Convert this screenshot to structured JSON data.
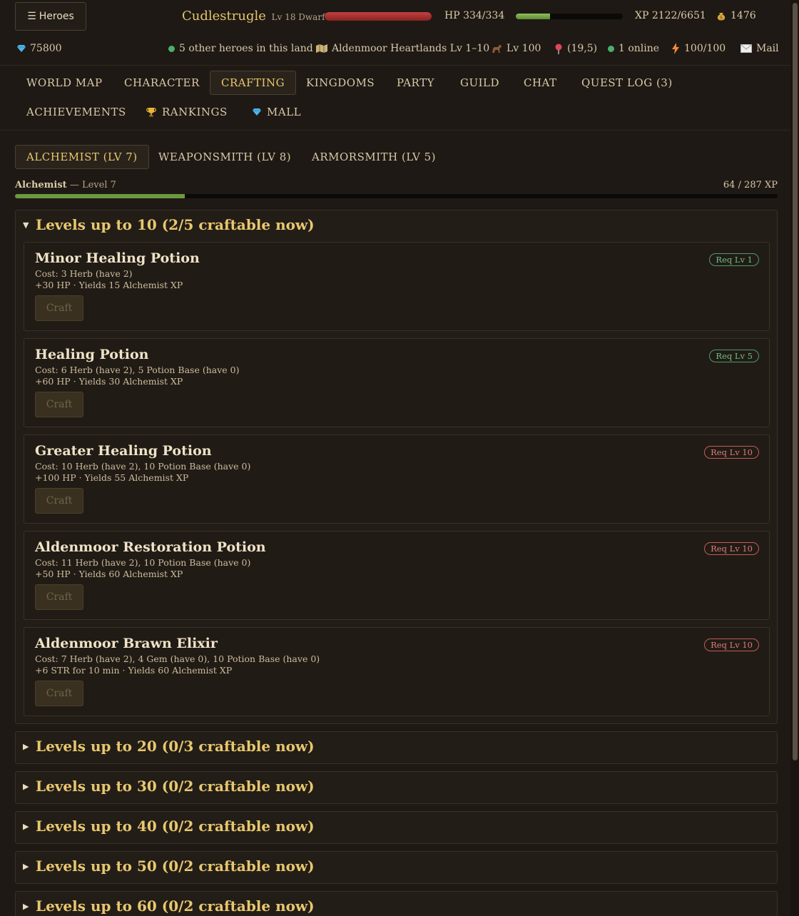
{
  "header": {
    "heroes_label": "Heroes",
    "character_name": "Cudlestrugle",
    "character_sub": "Lv 18 Dwarf",
    "hp_text": "HP 334/334",
    "hp_fraction": 1.0,
    "xp_text": "XP 2122/6651",
    "xp_fraction": 0.319,
    "gold": "1476",
    "gems": "75800",
    "heroes_nearby": "5 other heroes in this land",
    "region": "Aldenmoor Heartlands Lv 1–10",
    "mount_level": "Lv 100",
    "coords": "(19,5)",
    "online": "1 online",
    "energy": "100/100",
    "mail": "Mail"
  },
  "nav": {
    "tabs": [
      "WORLD MAP",
      "CHARACTER",
      "CRAFTING",
      "KINGDOMS",
      "PARTY",
      "GUILD",
      "CHAT",
      "QUEST LOG (3)",
      "ACHIEVEMENTS",
      "RANKINGS",
      "MALL"
    ],
    "active": "CRAFTING"
  },
  "professions": {
    "tabs": [
      "ALCHEMIST (LV 7)",
      "WEAPONSMITH (LV 8)",
      "ARMORSMITH (LV 5)"
    ],
    "active": "ALCHEMIST (LV 7)",
    "current_name": "Alchemist",
    "current_level": "— Level 7",
    "current_xp": "64 / 287 XP",
    "xp_fraction": 0.223
  },
  "sections": [
    {
      "title": "Levels up to 10 (2/5 craftable now)",
      "expanded": true,
      "recipes": [
        {
          "name": "Minor Healing Potion",
          "cost": "Cost: 3 Herb (have 2)",
          "effect": "+30 HP · Yields 15 Alchemist XP",
          "req": "Req Lv 1",
          "req_met": true,
          "craft_label": "Craft"
        },
        {
          "name": "Healing Potion",
          "cost": "Cost: 6 Herb (have 2), 5 Potion Base (have 0)",
          "effect": "+60 HP · Yields 30 Alchemist XP",
          "req": "Req Lv 5",
          "req_met": true,
          "craft_label": "Craft"
        },
        {
          "name": "Greater Healing Potion",
          "cost": "Cost: 10 Herb (have 2), 10 Potion Base (have 0)",
          "effect": "+100 HP · Yields 55 Alchemist XP",
          "req": "Req Lv 10",
          "req_met": false,
          "craft_label": "Craft"
        },
        {
          "name": "Aldenmoor Restoration Potion",
          "cost": "Cost: 11 Herb (have 2), 10 Potion Base (have 0)",
          "effect": "+50 HP · Yields 60 Alchemist XP",
          "req": "Req Lv 10",
          "req_met": false,
          "craft_label": "Craft"
        },
        {
          "name": "Aldenmoor Brawn Elixir",
          "cost": "Cost: 7 Herb (have 2), 4 Gem (have 0), 10 Potion Base (have 0)",
          "effect": "+6 STR for 10 min · Yields 60 Alchemist XP",
          "req": "Req Lv 10",
          "req_met": false,
          "craft_label": "Craft"
        }
      ]
    },
    {
      "title": "Levels up to 20 (0/3 craftable now)",
      "expanded": false
    },
    {
      "title": "Levels up to 30 (0/2 craftable now)",
      "expanded": false
    },
    {
      "title": "Levels up to 40 (0/2 craftable now)",
      "expanded": false
    },
    {
      "title": "Levels up to 50 (0/2 craftable now)",
      "expanded": false
    },
    {
      "title": "Levels up to 60 (0/2 craftable now)",
      "expanded": false
    }
  ],
  "colors": {
    "accent_gold": "#e8c86e",
    "hp_red": "#c24141",
    "xp_green": "#8fbf5a",
    "req_met": "#6cc08a",
    "req_unmet": "#e07a7a"
  }
}
